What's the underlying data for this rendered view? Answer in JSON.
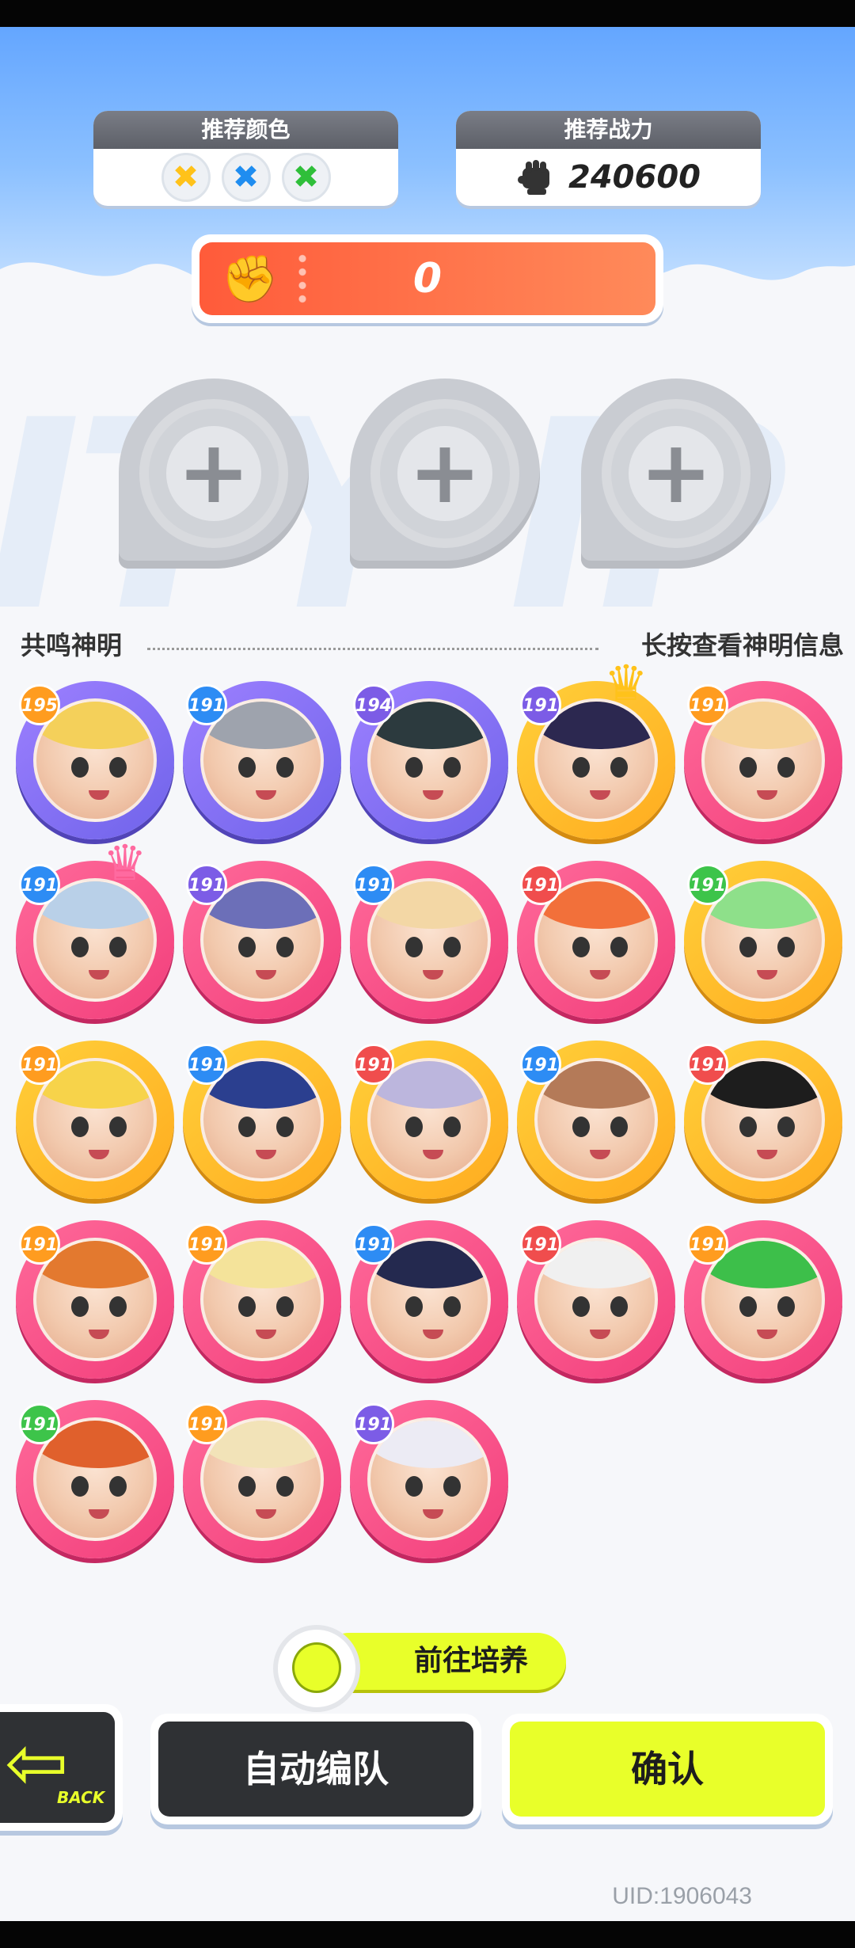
{
  "header": {
    "recommend_color_label": "推荐颜色",
    "recommend_power_label": "推荐战力",
    "recommend_colors": [
      {
        "symbol": "✖",
        "color": "#ffc21a"
      },
      {
        "symbol": "✖",
        "color": "#1f8df0"
      },
      {
        "symbol": "✖",
        "color": "#2fbf3a"
      }
    ],
    "recommend_power_value": "240600",
    "current_power_value": "0"
  },
  "section": {
    "left_label": "共鸣神明",
    "right_label": "长按查看神明信息"
  },
  "characters": [
    {
      "level": "195",
      "ring": "purple",
      "lvl_color": "orange",
      "hair": "#f4d05a",
      "crown": ""
    },
    {
      "level": "191",
      "ring": "purple",
      "lvl_color": "blue",
      "hair": "#9ea3ad",
      "crown": ""
    },
    {
      "level": "194",
      "ring": "purple",
      "lvl_color": "purple",
      "hair": "#2c3a3e",
      "crown": ""
    },
    {
      "level": "191",
      "ring": "yellow",
      "lvl_color": "purple",
      "hair": "#2c2850",
      "crown": "♛"
    },
    {
      "level": "191",
      "ring": "pink",
      "lvl_color": "orange",
      "hair": "#f5d39b",
      "crown": ""
    },
    {
      "level": "191",
      "ring": "pink",
      "lvl_color": "blue",
      "hair": "#b9d0e8",
      "crown": "♛"
    },
    {
      "level": "191",
      "ring": "pink",
      "lvl_color": "purple",
      "hair": "#6c6fb8",
      "crown": ""
    },
    {
      "level": "191",
      "ring": "pink",
      "lvl_color": "blue",
      "hair": "#f3d7a5",
      "crown": ""
    },
    {
      "level": "191",
      "ring": "pink",
      "lvl_color": "red",
      "hair": "#f2703a",
      "crown": ""
    },
    {
      "level": "191",
      "ring": "yellow",
      "lvl_color": "green",
      "hair": "#8ee08a",
      "crown": ""
    },
    {
      "level": "191",
      "ring": "yellow",
      "lvl_color": "orange",
      "hair": "#f7d34a",
      "crown": ""
    },
    {
      "level": "191",
      "ring": "yellow",
      "lvl_color": "blue",
      "hair": "#2b3f8f",
      "crown": ""
    },
    {
      "level": "191",
      "ring": "yellow",
      "lvl_color": "red",
      "hair": "#bcb6dd",
      "crown": ""
    },
    {
      "level": "191",
      "ring": "yellow",
      "lvl_color": "blue",
      "hair": "#b47a58",
      "crown": ""
    },
    {
      "level": "191",
      "ring": "yellow",
      "lvl_color": "red",
      "hair": "#1d1d1d",
      "crown": ""
    },
    {
      "level": "191",
      "ring": "pink",
      "lvl_color": "orange",
      "hair": "#e3792f",
      "crown": ""
    },
    {
      "level": "191",
      "ring": "pink",
      "lvl_color": "orange",
      "hair": "#f4e39a",
      "crown": ""
    },
    {
      "level": "191",
      "ring": "pink",
      "lvl_color": "blue",
      "hair": "#24294f",
      "crown": ""
    },
    {
      "level": "191",
      "ring": "pink",
      "lvl_color": "red",
      "hair": "#f0f0f0",
      "crown": ""
    },
    {
      "level": "191",
      "ring": "pink",
      "lvl_color": "orange",
      "hair": "#3dbf4a",
      "crown": ""
    },
    {
      "level": "191",
      "ring": "pink",
      "lvl_color": "green",
      "hair": "#e0602c",
      "crown": ""
    },
    {
      "level": "191",
      "ring": "pink",
      "lvl_color": "orange",
      "hair": "#f2e3b8",
      "crown": ""
    },
    {
      "level": "191",
      "ring": "pink",
      "lvl_color": "purple",
      "hair": "#ecebf4",
      "crown": ""
    }
  ],
  "buttons": {
    "cultivate": "前往培养",
    "back": "BACK",
    "auto_team": "自动编队",
    "confirm": "确认"
  },
  "uid": "UID:1906043"
}
